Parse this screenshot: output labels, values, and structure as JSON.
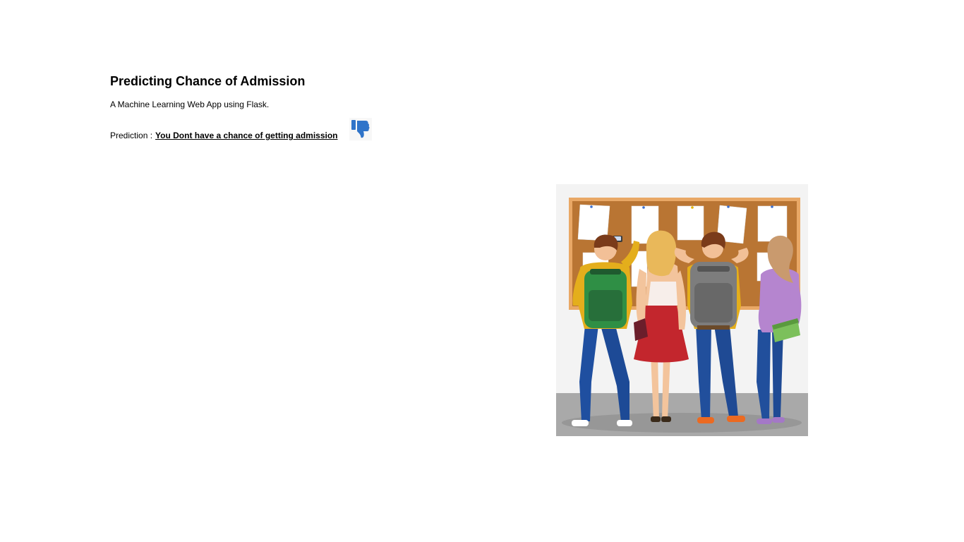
{
  "page": {
    "title": "Predicting Chance of Admission",
    "subtitle": "A Machine Learning Web App using Flask."
  },
  "prediction": {
    "label": "Prediction :",
    "result": "You Dont have a chance of getting admission",
    "icon": "thumbs-down-icon",
    "icon_color": "#2f74c9"
  },
  "illustration": {
    "icon": "students-at-notice-board-image",
    "board_color": "#b97533",
    "frame_color": "#e9a866",
    "floor_color": "#a9a9a9",
    "wall_color": "#f3f3f3"
  }
}
